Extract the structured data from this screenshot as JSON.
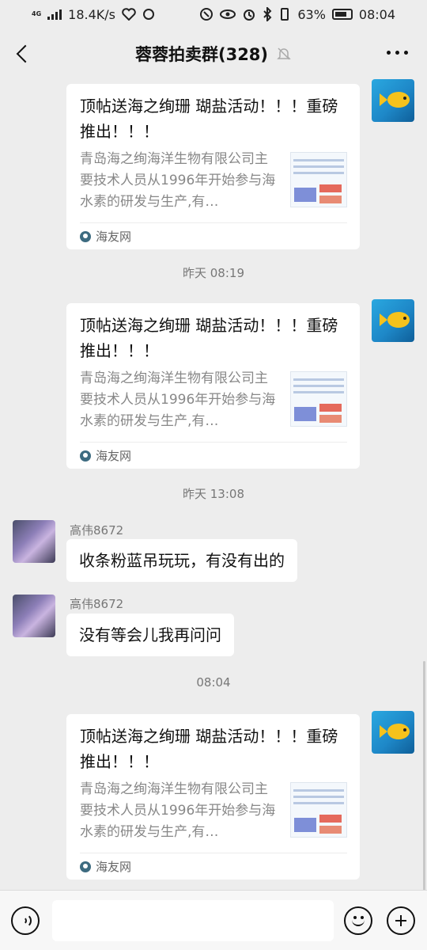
{
  "status_bar": {
    "network_type": "4G",
    "speed": "18.4K/s",
    "battery": "63%",
    "time": "08:04"
  },
  "header": {
    "title": "蓉蓉拍卖群(328)"
  },
  "share_card": {
    "title": "顶帖送海之绚珊 瑚盐活动！！！重磅推出！！！",
    "description": "青岛海之绚海洋生物有限公司主要技术人员从1996年开始参与海水素的研发与生产,有…",
    "source": "海友网"
  },
  "messages": [
    {
      "type": "card",
      "card_ref": "share_card"
    },
    {
      "type": "time",
      "text": "昨天 08:19"
    },
    {
      "type": "card",
      "card_ref": "share_card"
    },
    {
      "type": "time",
      "text": "昨天 13:08"
    },
    {
      "type": "text",
      "sender": "高伟8672",
      "text": "收条粉蓝吊玩玩，有没有出的"
    },
    {
      "type": "text",
      "sender": "高伟8672",
      "text": "没有等会儿我再问问"
    },
    {
      "type": "time",
      "text": "08:04"
    },
    {
      "type": "card",
      "card_ref": "share_card"
    }
  ],
  "colors": {
    "background": "#ededed",
    "bubble": "#ffffff",
    "meta_text": "#777777"
  },
  "icons": [
    "back-arrow-icon",
    "mute-bell-icon",
    "more-icon",
    "voice-icon",
    "emoji-icon",
    "plus-icon"
  ]
}
